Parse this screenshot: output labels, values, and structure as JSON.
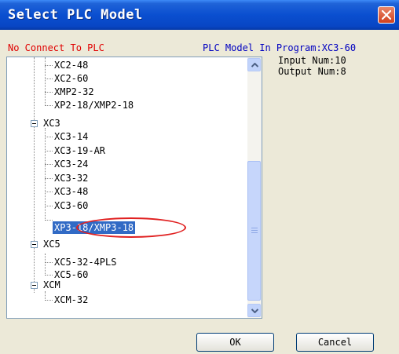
{
  "window": {
    "title": "Select PLC Model"
  },
  "status": "No Connect To PLC",
  "program_model": "PLC Model In Program:XC3-60",
  "input_num": "Input Num:10",
  "output_num": "Output Num:8",
  "tree": {
    "items": [
      "XC2-48",
      "XC2-60",
      "XMP2-32",
      "XP2-18/XMP2-18",
      "XC3",
      "XC3-14",
      "XC3-19-AR",
      "XC3-24",
      "XC3-32",
      "XC3-48",
      "XC3-60",
      "XP3-18/XMP3-18",
      "XC5",
      "XC5-32-4PLS",
      "XC5-60",
      "XCM",
      "XCM-32"
    ],
    "selected": "XP3-18/XMP3-18"
  },
  "buttons": {
    "ok": "OK",
    "cancel": "Cancel"
  },
  "colors": {
    "titlebar": "#0a4fd0",
    "status": "#e00000",
    "model": "#0000c0",
    "selection": "#316ac5",
    "annotation": "#e02020"
  },
  "icons": {
    "close": "close-icon",
    "scroll_up": "chevron-up-icon",
    "scroll_down": "chevron-down-icon"
  }
}
